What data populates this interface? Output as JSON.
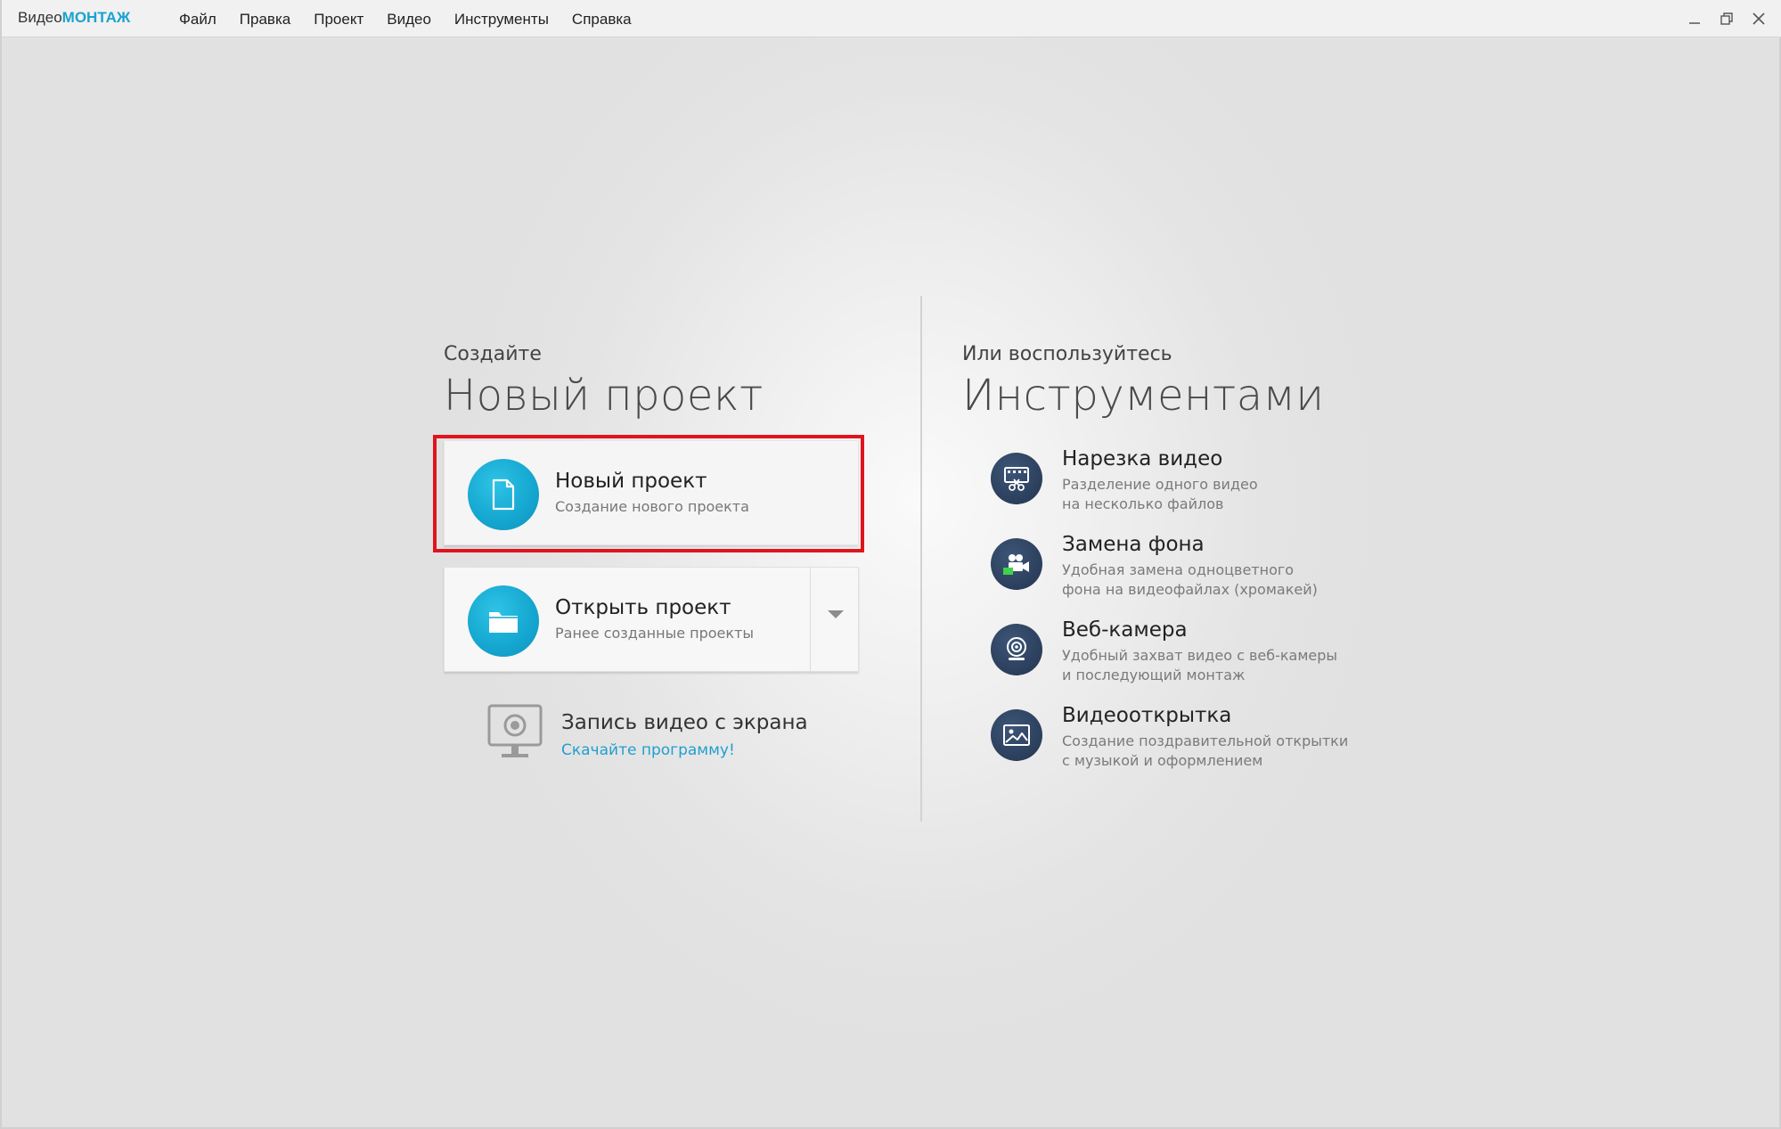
{
  "app": {
    "brand_plain": "Видео",
    "brand_accent": "МОНТАЖ"
  },
  "menu": {
    "items": [
      "Файл",
      "Правка",
      "Проект",
      "Видео",
      "Инструменты",
      "Справка"
    ]
  },
  "window_controls": {
    "minimize": "—",
    "restore": "❐",
    "close": "✕"
  },
  "create": {
    "kicker": "Создайте",
    "title": "Новый проект"
  },
  "new_project": {
    "title": "Новый проект",
    "subtitle": "Создание нового проекта",
    "icon": "document-icon"
  },
  "open_project": {
    "title": "Открыть проект",
    "subtitle": "Ранее созданные проекты",
    "icon": "folder-icon"
  },
  "screen_recording": {
    "title": "Запись видео с экрана",
    "link": "Скачайте программу!",
    "icon": "monitor-icon"
  },
  "tools": {
    "kicker": "Или воспользуйтесь",
    "title": "Инструментами",
    "items": [
      {
        "title": "Нарезка видео",
        "desc1": "Разделение одного видео",
        "desc2": "на несколько файлов",
        "icon": "video-cut-icon"
      },
      {
        "title": "Замена фона",
        "desc1": "Удобная замена одноцветного",
        "desc2": "фона на видеофайлах (хромакей)",
        "icon": "chroma-key-icon"
      },
      {
        "title": "Веб-камера",
        "desc1": "Удобный захват видео с веб-камеры",
        "desc2": "и последующий монтаж",
        "icon": "webcam-icon"
      },
      {
        "title": "Видеооткрытка",
        "desc1": "Создание поздравительной открытки",
        "desc2": "с музыкой и оформлением",
        "icon": "postcard-icon"
      }
    ]
  },
  "colors": {
    "accent": "#1aa3d0",
    "highlight": "#e0141e",
    "tool_icon_bg": "#2b3f5c"
  }
}
